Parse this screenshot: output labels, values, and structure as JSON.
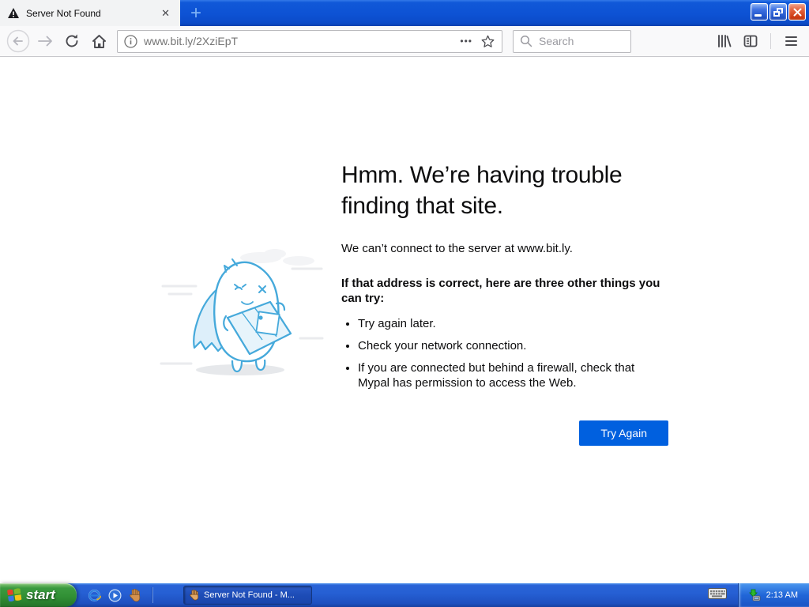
{
  "titlebar": {
    "tab_title": "Server Not Found",
    "tab_icon": "warning-icon",
    "controls": [
      "minimize",
      "restore",
      "close"
    ]
  },
  "icons": {
    "close_glyph": "✕",
    "plus_glyph": "+",
    "page_actions_glyph": "•••"
  },
  "navbar": {
    "url": "www.bit.ly/2XziEpT",
    "search_placeholder": "Search",
    "buttons": [
      "back",
      "forward",
      "reload",
      "home",
      "page-actions",
      "bookmark-star",
      "library",
      "sidebar",
      "menu"
    ]
  },
  "error_page": {
    "title": "Hmm. We’re having trouble finding that site.",
    "description": "We can’t connect to the server at www.bit.ly.",
    "subtitle": "If that address is correct, here are three other things you can try:",
    "bullets": [
      "Try again later.",
      "Check your network connection.",
      "If you are connected but behind a firewall, check that Mypal has permission to access the Web."
    ],
    "button_label": "Try Again",
    "accent_color": "#0060df"
  },
  "taskbar": {
    "start_label": "start",
    "quick_launch": [
      "internet-explorer",
      "media-player",
      "mypal"
    ],
    "task_button_label": "Server Not Found - M...",
    "time": "2:13 AM"
  }
}
